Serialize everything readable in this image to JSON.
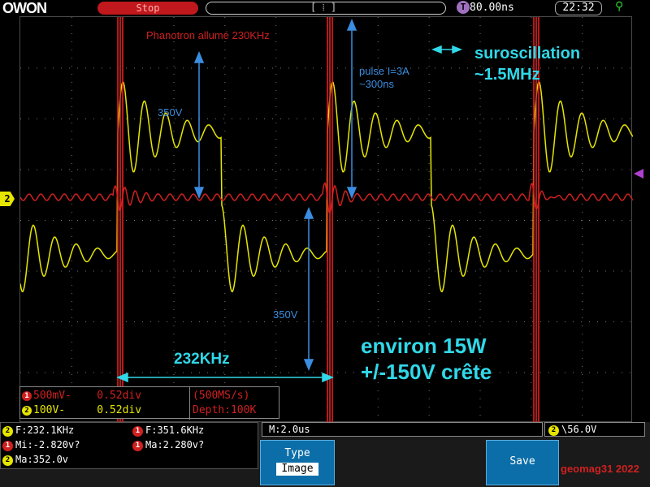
{
  "header": {
    "logo": "OWON",
    "run_state": "Stop",
    "trigger_marker": "T",
    "timebase_icon": "T",
    "timebase": "80.00ns",
    "clock": "22:32",
    "usb_icon": "usb-icon"
  },
  "screen": {
    "ch2_marker": "2",
    "annotations": {
      "phanotron": "Phanotron allumé 230KHz",
      "v350_top": "350V",
      "v350_bottom": "350V",
      "pulse_line1": "pulse I=3A",
      "pulse_line2": "~300ns",
      "suro_line1": "suroscillation",
      "suro_line2": "~1.5MHz",
      "freq": "232KHz",
      "power_line1": "environ 15W",
      "power_line2": "+/-150V crête"
    }
  },
  "channel_info": {
    "ch1": {
      "num": "1",
      "scale": "500mV-",
      "offset": "0.52div"
    },
    "ch2": {
      "num": "2",
      "scale": "100V-",
      "offset": "0.52div"
    },
    "sample_rate": "(500MS/s)",
    "depth": "Depth:100K"
  },
  "measurements": {
    "m1": {
      "ch": "2",
      "text": "F:232.1KHz"
    },
    "m2": {
      "ch": "1",
      "text": "F:351.6KHz"
    },
    "m3": {
      "ch": "1",
      "text": "Mi:-2.820v?"
    },
    "m4": {
      "ch": "1",
      "text": "Ma:2.280v?"
    },
    "m5": {
      "ch": "2",
      "text": "Ma:352.0v"
    }
  },
  "bottom": {
    "main_time": "M:2.0us",
    "trigger_ch": "2",
    "trigger_level": "56.0V",
    "type_button": {
      "label": "Type",
      "value": "Image"
    },
    "save_button": {
      "label": "Save"
    },
    "watermark": "geomag31 2022"
  },
  "colors": {
    "ch1": "#d02020",
    "ch2": "#e6e600",
    "annotation_cyan": "#30d8e8",
    "annotation_blue": "#3a8de0",
    "button": "#0c6ea8"
  }
}
